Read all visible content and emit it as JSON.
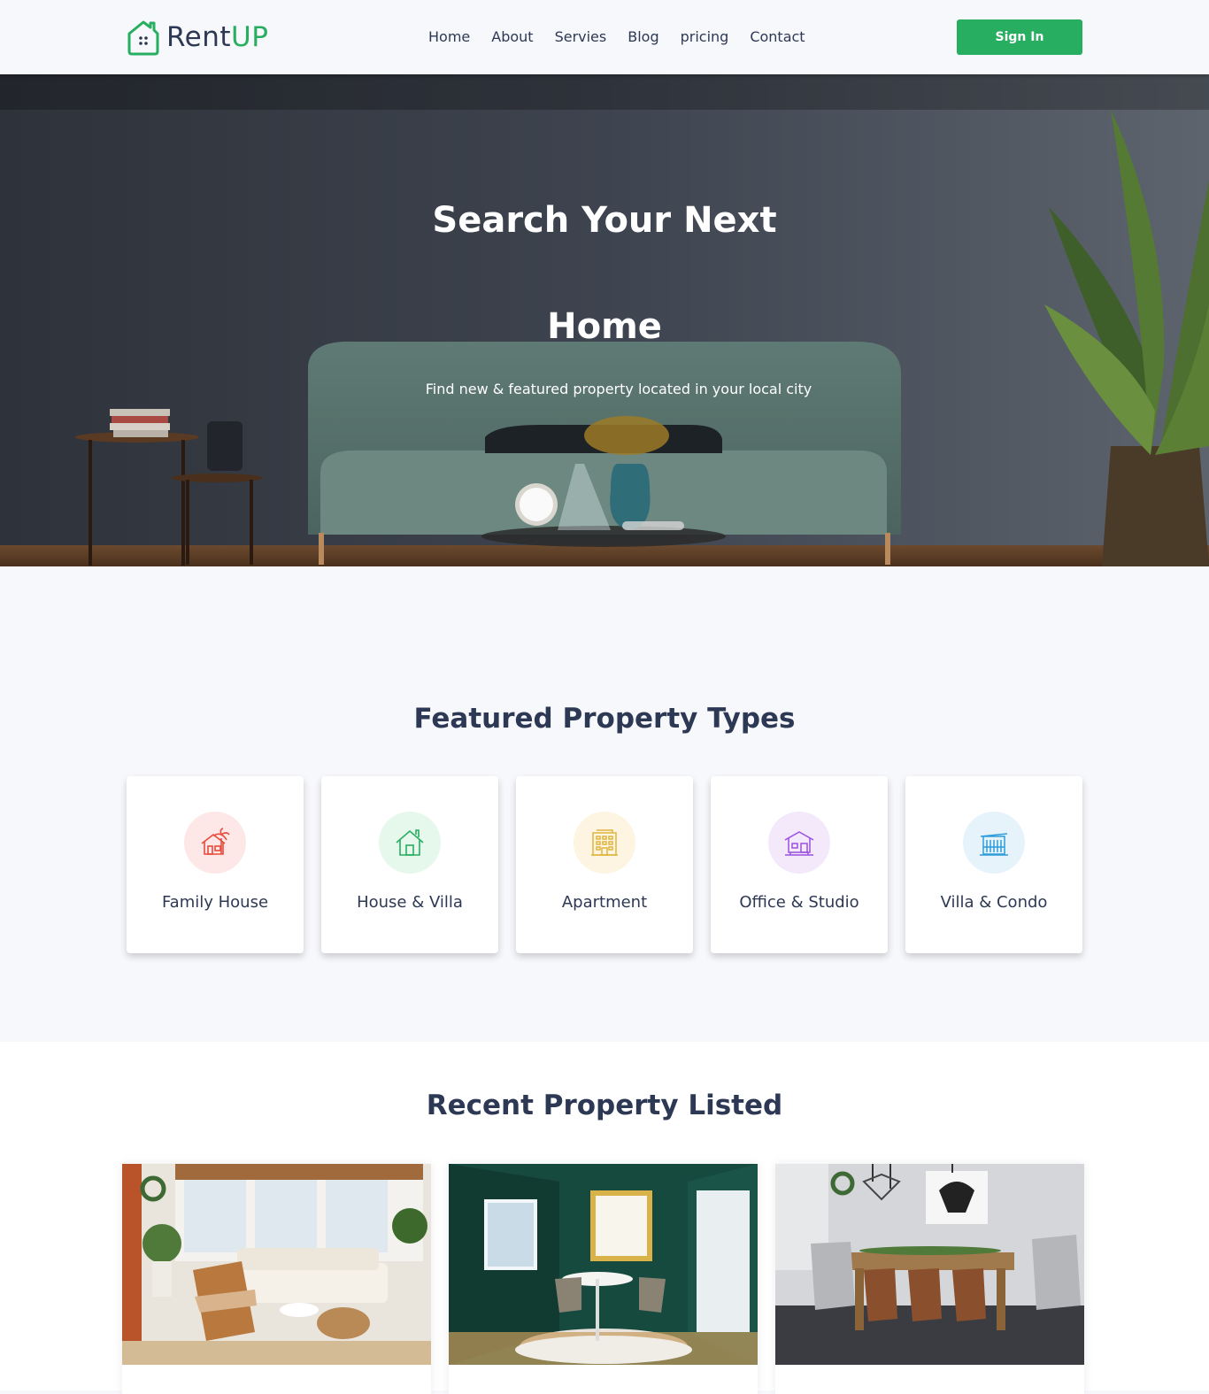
{
  "header": {
    "logo": {
      "brand_part1": "Rent",
      "brand_part2": "UP",
      "icon": "house-logo-icon"
    },
    "nav": [
      "Home",
      "About",
      "Servies",
      "Blog",
      "pricing",
      "Contact"
    ],
    "signin_label": "Sign In"
  },
  "hero": {
    "title_line1": "Search Your Next",
    "title_line2": "Home",
    "subtitle": "Find new & featured property located in your local city"
  },
  "featured": {
    "title": "Featured Property Types",
    "types": [
      {
        "label": "Family House",
        "icon": "beach-house-icon",
        "color": "#e74c3c",
        "bg": "#fde7e7"
      },
      {
        "label": "House & Villa",
        "icon": "house-icon",
        "color": "#27ae60",
        "bg": "#e6f7ec"
      },
      {
        "label": "Apartment",
        "icon": "apartment-building-icon",
        "color": "#e0b43c",
        "bg": "#fdf4e1"
      },
      {
        "label": "Office & Studio",
        "icon": "office-building-icon",
        "color": "#9b51e0",
        "bg": "#f3e9fb"
      },
      {
        "label": "Villa & Condo",
        "icon": "condo-building-icon",
        "color": "#2d9cdb",
        "bg": "#e7f3fb"
      }
    ]
  },
  "recent": {
    "title": "Recent Property Listed"
  },
  "colors": {
    "accent": "#27ae60",
    "text": "#2d3954"
  }
}
